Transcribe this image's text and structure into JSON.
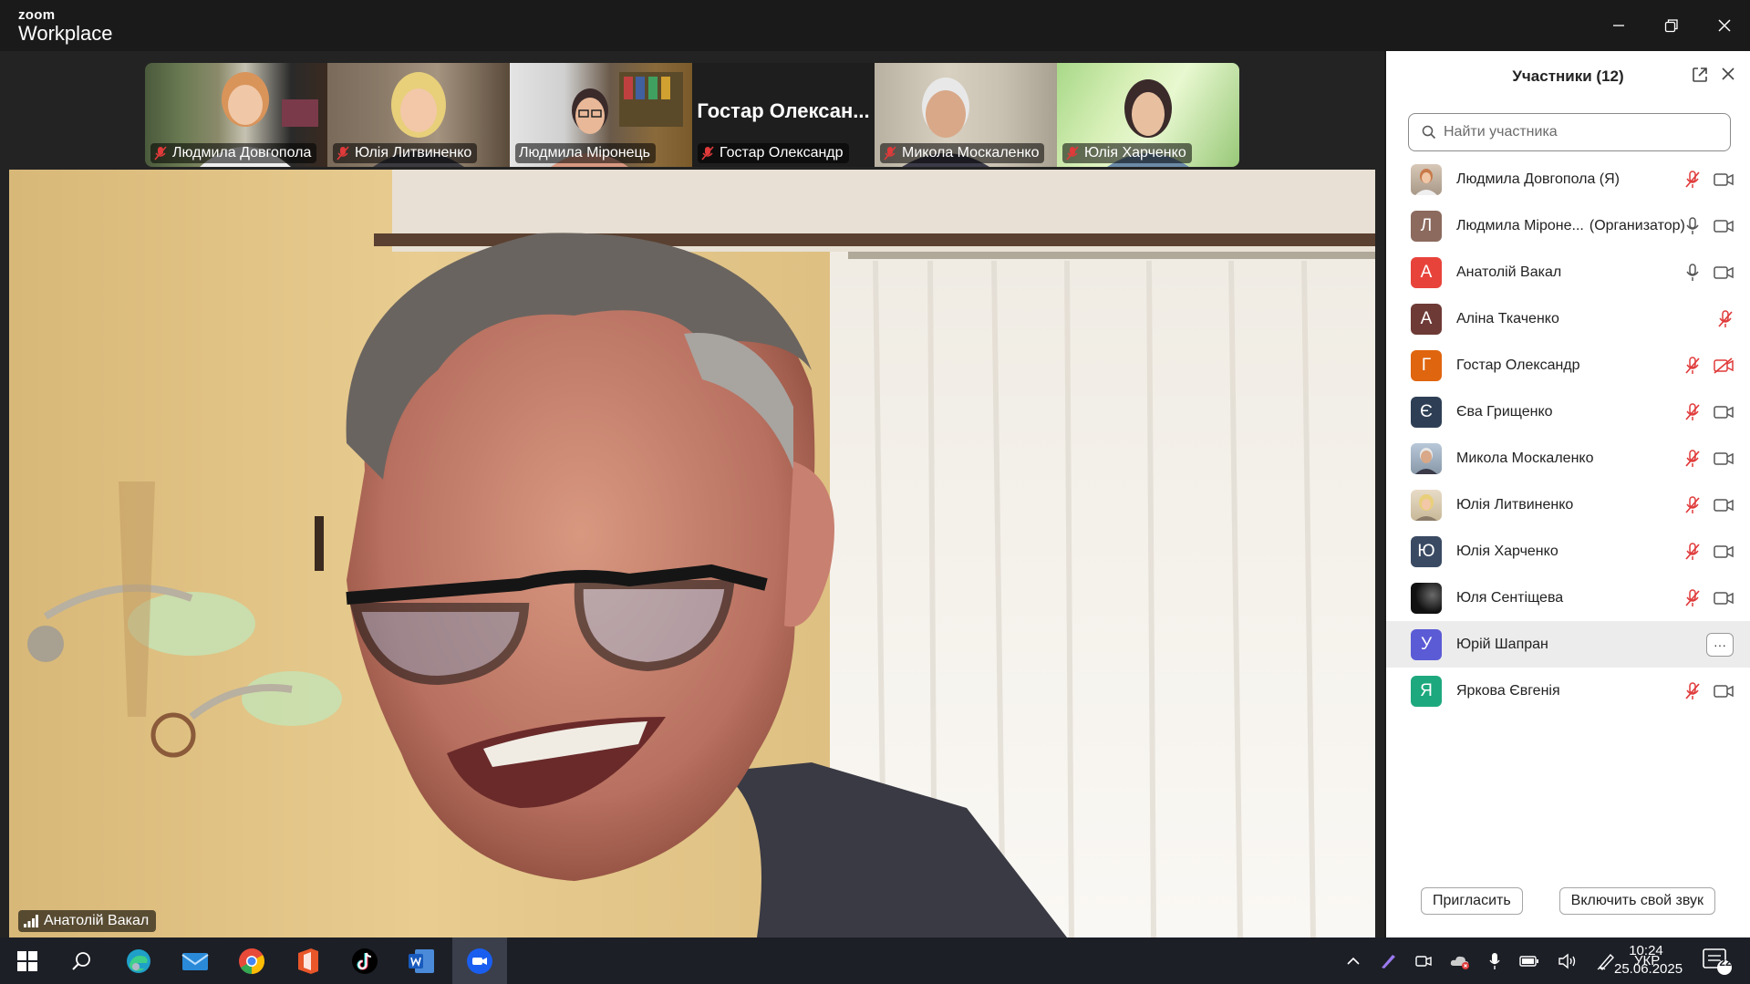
{
  "app": {
    "brand_top": "zoom",
    "brand_bottom": "Workplace"
  },
  "thumbnails": [
    {
      "name": "Людмила Довгопола"
    },
    {
      "name": "Юлія Литвиненко"
    },
    {
      "name": "Людмила Міронець"
    },
    {
      "name": "Гостар Олександр",
      "big_label": "Гостар  Олексан..."
    },
    {
      "name": "Микола Москаленко"
    },
    {
      "name": "Юлія Харченко"
    }
  ],
  "main_video": {
    "speaker": "Анатолій Вакал"
  },
  "panel": {
    "title": "Участники (12)",
    "search_placeholder": "Найти участника",
    "participants": [
      {
        "name": "Людмила Довгопола (Я)",
        "role": "",
        "avatar": "photo",
        "mic": "muted",
        "cam": "on"
      },
      {
        "name": "Людмила Міроне...",
        "role": "(Организатор)",
        "avatar": "Л",
        "color": "#8c6a5e",
        "mic": "on",
        "cam": "on"
      },
      {
        "name": "Анатолій Вакал",
        "role": "",
        "avatar": "А",
        "color": "#e8433a",
        "mic": "on",
        "cam": "on"
      },
      {
        "name": "Аліна Ткаченко",
        "role": "",
        "avatar": "А",
        "color": "#6e3a36",
        "mic": "muted",
        "cam": "none"
      },
      {
        "name": "Гостар Олександр",
        "role": "",
        "avatar": "Г",
        "color": "#e0650f",
        "mic": "muted",
        "cam": "off"
      },
      {
        "name": "Єва Грищенко",
        "role": "",
        "avatar": "Є",
        "color": "#2e3f55",
        "mic": "muted",
        "cam": "on"
      },
      {
        "name": "Микола Москаленко",
        "role": "",
        "avatar": "photo",
        "mic": "muted",
        "cam": "on"
      },
      {
        "name": "Юлія Литвиненко",
        "role": "",
        "avatar": "photo",
        "mic": "muted",
        "cam": "on"
      },
      {
        "name": "Юлія Харченко",
        "role": "",
        "avatar": "Ю",
        "color": "#3a4a63",
        "mic": "muted",
        "cam": "on"
      },
      {
        "name": "Юля Сентіщева",
        "role": "",
        "avatar": "photo",
        "mic": "muted",
        "cam": "on"
      },
      {
        "name": "Юрій Шапран",
        "role": "",
        "avatar": "У",
        "color": "#5b5bd6",
        "mic": "none",
        "cam": "none",
        "more": "···"
      },
      {
        "name": "Яркова Євгенія",
        "role": "",
        "avatar": "Я",
        "color": "#1ea87e",
        "mic": "muted",
        "cam": "on"
      }
    ],
    "invite_label": "Пригласить",
    "unmute_label": "Включить свой звук"
  },
  "taskbar": {
    "lang": "УКР",
    "time": "10:24",
    "date": "25.06.2025",
    "notifications": "22"
  }
}
